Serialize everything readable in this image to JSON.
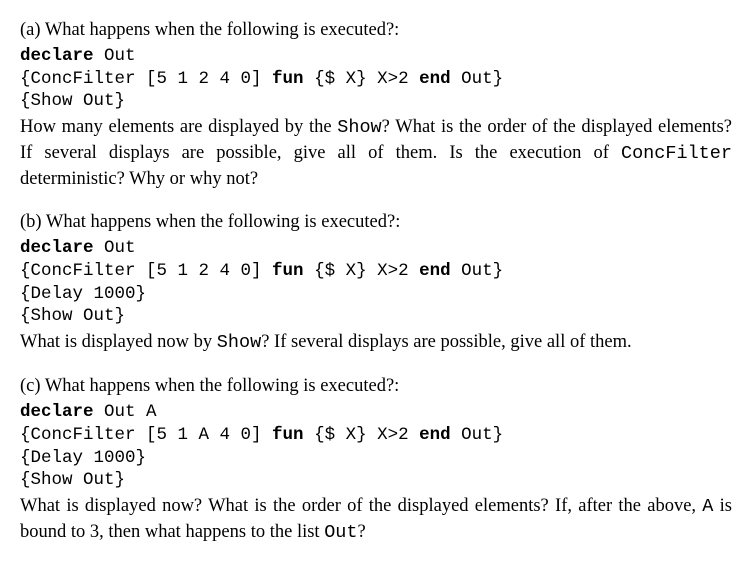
{
  "a": {
    "label": "(a)",
    "prompt": " What happens when the following is executed?:",
    "declare": "declare",
    "declare_vars": " Out",
    "line1a": "{ConcFilter [5 1 2 4 0] ",
    "fun": "fun",
    "line1b": " {$ X} X>2 ",
    "end": "end",
    "line1c": " Out}",
    "line2": "{Show Out}",
    "q1a": "How many elements are displayed by the ",
    "q1_show": "Show",
    "q1b": "? What is the order of the displayed elements? If several displays are possible, give all of them. Is the execution of ",
    "q1_cf": "ConcFilter",
    "q1c": " deterministic? Why or why not?"
  },
  "b": {
    "label": "(b)",
    "prompt": " What happens when the following is executed?:",
    "declare": "declare",
    "declare_vars": " Out",
    "line1a": "{ConcFilter [5 1 2 4 0] ",
    "fun": "fun",
    "line1b": " {$ X} X>2 ",
    "end": "end",
    "line1c": " Out}",
    "line_delay": "{Delay 1000}",
    "line_show": "{Show Out}",
    "q1a": "What is displayed now by ",
    "q1_show": "Show",
    "q1b": "? If several displays are possible, give all of them."
  },
  "c": {
    "label": "(c)",
    "prompt": " What happens when the following is executed?:",
    "declare": "declare",
    "declare_vars": " Out A",
    "line1a": "{ConcFilter [5 1 A 4 0] ",
    "fun": "fun",
    "line1b": " {$ X} X>2 ",
    "end": "end",
    "line1c": " Out}",
    "line_delay": "{Delay 1000}",
    "line_show": "{Show Out}",
    "q1a": "What is displayed now? What is the order of the displayed elements? If, after the above, ",
    "q1_A": "A",
    "q1b": " is bound to 3, then what happens to the list ",
    "q1_out": "Out",
    "q1c": "?"
  }
}
